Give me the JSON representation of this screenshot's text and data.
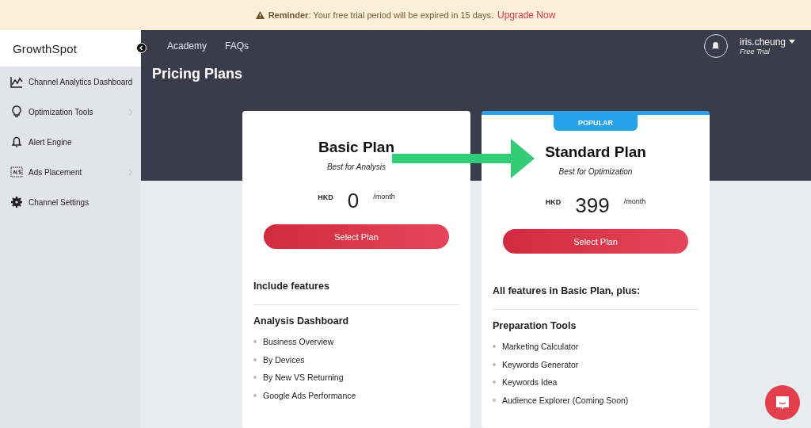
{
  "banner": {
    "label": "Reminder",
    "message": ": Your free trial period will be expired in 15 days.",
    "link": "Upgrade Now"
  },
  "sidebar": {
    "logo": "GrowthSpot",
    "items": [
      {
        "label": "Channel Analytics Dashboard",
        "kind": "chart",
        "expandable": false
      },
      {
        "label": "Optimization Tools",
        "kind": "bulb",
        "expandable": true
      },
      {
        "label": "Alert Engine",
        "kind": "bell",
        "expandable": false
      },
      {
        "label": "Ads Placement",
        "kind": "ads",
        "expandable": true
      },
      {
        "label": "Channel Settings",
        "kind": "gear",
        "expandable": false
      }
    ]
  },
  "nav": {
    "links": [
      "Academy",
      "FAQs"
    ],
    "user": {
      "name": "iris.cheung",
      "plan": "Free Trial"
    }
  },
  "page_title": "Pricing Plans",
  "plans": [
    {
      "name": "Basic Plan",
      "tagline": "Best for Analysis",
      "currency": "HKD",
      "price": "0",
      "period": "/month",
      "button": "Select Plan",
      "popular": false,
      "features_title": "Include features",
      "group": "Analysis Dashboard",
      "features": [
        "Business Overview",
        "By Devices",
        "By New VS Returning",
        "Google Ads Performance"
      ]
    },
    {
      "name": "Standard Plan",
      "tagline": "Best for Optimization",
      "currency": "HKD",
      "price": "399",
      "period": "/month",
      "button": "Select Plan",
      "popular": true,
      "badge": "POPULAR",
      "features_title": "All features in Basic Plan, plus:",
      "group": "Preparation Tools",
      "features": [
        "Marketing Calculator",
        "Keywords Generator",
        "Keywords Idea",
        "Audience Explorer (Coming Soon)"
      ]
    }
  ]
}
